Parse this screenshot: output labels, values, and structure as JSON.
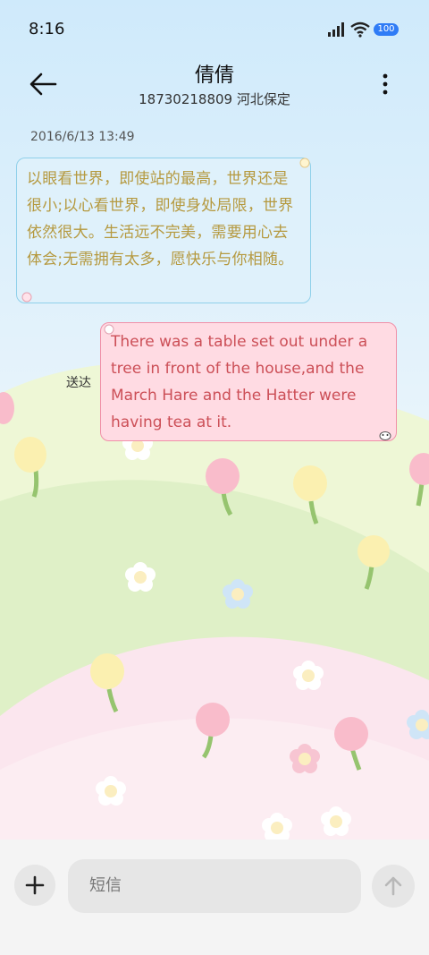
{
  "status": {
    "time": "8:16",
    "battery": "100"
  },
  "header": {
    "contact_name": "倩倩",
    "subtitle": "18730218809 河北保定"
  },
  "thread": {
    "timestamp": "2016/6/13 13:49",
    "messages": [
      {
        "direction": "incoming",
        "text": "以眼看世界，即使站的最高，世界还是很小;以心看世界，即使身处局限，世界依然很大。生活远不完美，需要用心去体会;无需拥有太多，愿快乐与你相随。"
      },
      {
        "direction": "outgoing",
        "status": "送达",
        "text": "There was a table set out under a tree in front of the house,and the March Hare and the Hatter were having tea at it."
      }
    ]
  },
  "composer": {
    "placeholder": "短信"
  },
  "icons": {
    "back": "arrow-left-icon",
    "more": "more-vertical-icon",
    "add": "plus-icon",
    "send": "arrow-up-icon"
  },
  "colors": {
    "incoming_text": "#b5993f",
    "outgoing_text": "#cc4f57",
    "incoming_border": "#8fd0ea",
    "outgoing_border": "#f090a8"
  }
}
